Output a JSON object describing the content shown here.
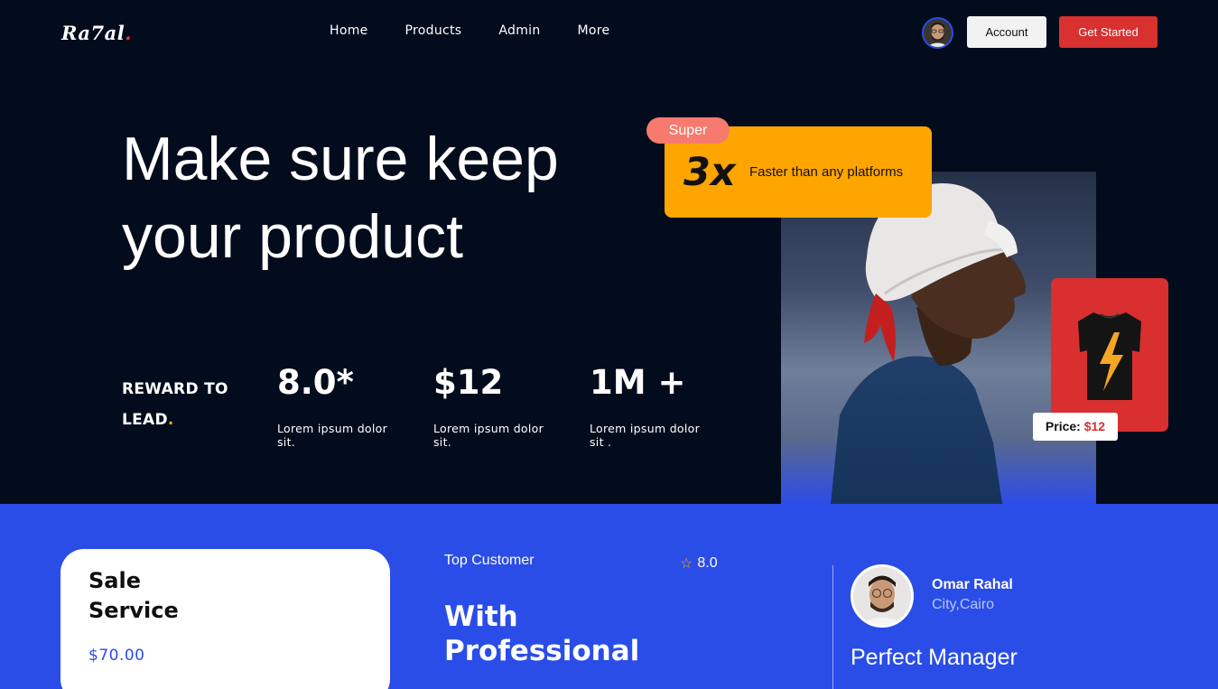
{
  "brand": {
    "name": "Ra7al",
    "dot": "."
  },
  "nav": {
    "items": [
      "Home",
      "Products",
      "Admin",
      "More"
    ]
  },
  "header": {
    "account_label": "Account",
    "get_started_label": "Get Started"
  },
  "hero": {
    "title_line1": "Make sure keep",
    "title_line2": "your product",
    "reward_line1": "REWARD TO",
    "reward_line2": "LEAD",
    "reward_dot": ".",
    "stats": [
      {
        "value": "8.0*",
        "caption": "Lorem ipsum dolor sit."
      },
      {
        "value": "$12",
        "caption": "Lorem ipsum dolor sit."
      },
      {
        "value": "1M +",
        "caption": "Lorem ipsum dolor sit ."
      }
    ]
  },
  "speed_card": {
    "badge": "Super",
    "big": "3x",
    "text": "Faster than any platforms"
  },
  "product_card": {
    "price_label": "Price:",
    "price_value": "$12"
  },
  "sale_card": {
    "title": "Sale Service",
    "price": "$70.00"
  },
  "customer": {
    "label": "Top Customer",
    "rating": "8.0",
    "title_line1": "With",
    "title_line2": "Professional"
  },
  "manager": {
    "name": "Omar Rahal",
    "city": "City,Cairo",
    "role": "Perfect Manager"
  },
  "colors": {
    "background": "#030c1c",
    "accent_blue": "#2a4de8",
    "accent_red": "#d93030",
    "accent_orange": "#ffa500",
    "badge_coral": "#f77a6e"
  },
  "icons": [
    "user-avatar",
    "star-icon",
    "tshirt-image",
    "model-photo"
  ]
}
